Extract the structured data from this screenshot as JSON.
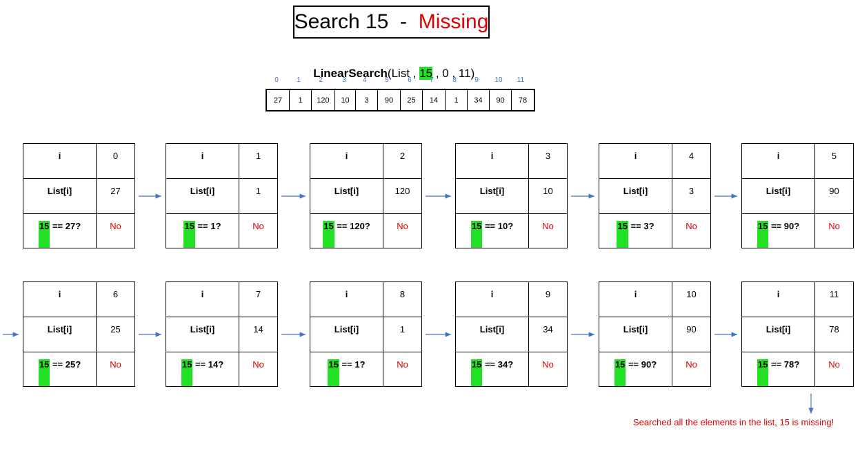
{
  "title": {
    "prefix": "Search 15  -  ",
    "status": "Missing"
  },
  "call": {
    "func": "LinearSearch",
    "open": "(List , ",
    "target": "15",
    "rest": " , 0 , 11)"
  },
  "array": {
    "indices": [
      "0",
      "1",
      "2",
      "3",
      "4",
      "5",
      "6",
      "7",
      "8",
      "9",
      "10",
      "11"
    ],
    "values": [
      "27",
      "1",
      "120",
      "10",
      "3",
      "90",
      "25",
      "14",
      "1",
      "34",
      "90",
      "78"
    ]
  },
  "labels": {
    "i": "i",
    "list_i": "List[i]",
    "target": "15"
  },
  "steps": [
    {
      "i": "0",
      "value": "27",
      "compare": " == 27?",
      "result": "No"
    },
    {
      "i": "1",
      "value": "1",
      "compare": " == 1?",
      "result": "No"
    },
    {
      "i": "2",
      "value": "120",
      "compare": " == 120?",
      "result": "No"
    },
    {
      "i": "3",
      "value": "10",
      "compare": " == 10?",
      "result": "No"
    },
    {
      "i": "4",
      "value": "3",
      "compare": " == 3?",
      "result": "No"
    },
    {
      "i": "5",
      "value": "90",
      "compare": " == 90?",
      "result": "No"
    },
    {
      "i": "6",
      "value": "25",
      "compare": " == 25?",
      "result": "No"
    },
    {
      "i": "7",
      "value": "14",
      "compare": " == 14?",
      "result": "No"
    },
    {
      "i": "8",
      "value": "1",
      "compare": " == 1?",
      "result": "No"
    },
    {
      "i": "9",
      "value": "34",
      "compare": " == 34?",
      "result": "No"
    },
    {
      "i": "10",
      "value": "90",
      "compare": " == 90?",
      "result": "No"
    },
    {
      "i": "11",
      "value": "78",
      "compare": " == 78?",
      "result": "No"
    }
  ],
  "conclusion": "Searched all the elements in the list, 15 is missing!",
  "colors": {
    "highlight": "#22e022",
    "result": "#e00000",
    "index": "#4472c4",
    "arrow": "#4472c4"
  }
}
